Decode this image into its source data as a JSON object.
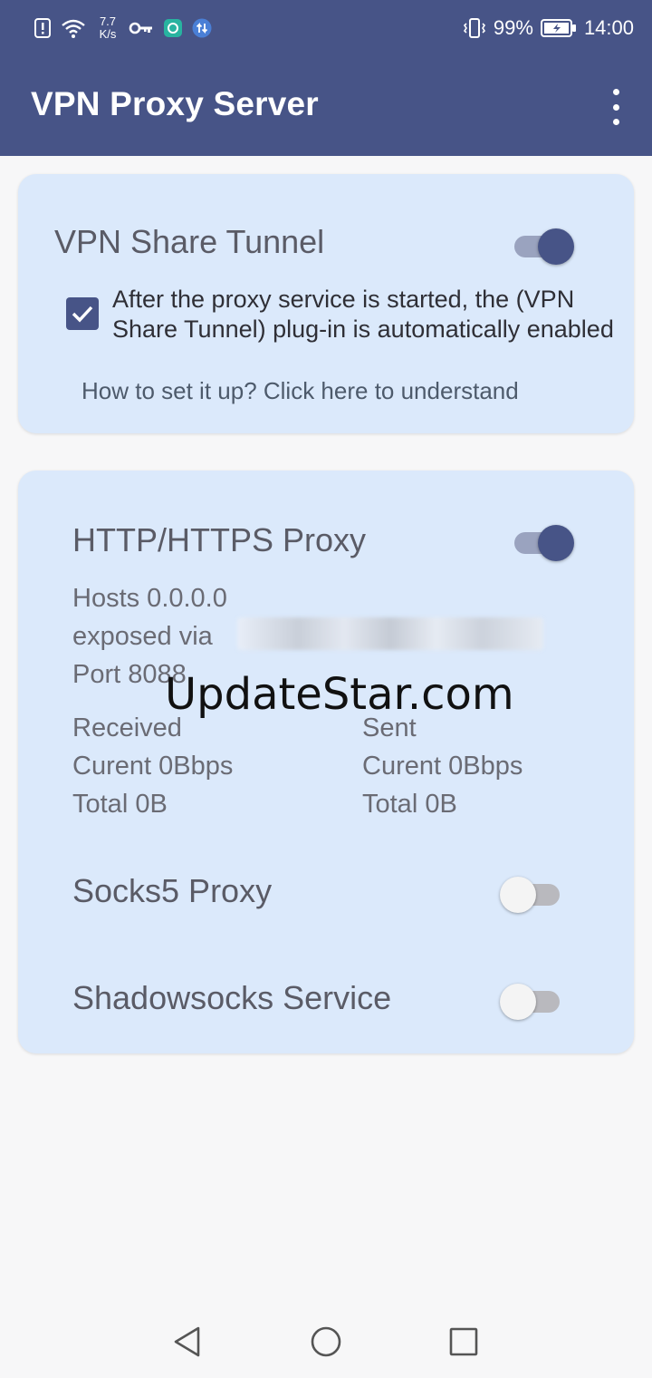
{
  "status_bar": {
    "net_speed_value": "7.7",
    "net_speed_unit": "K/s",
    "battery": "99%",
    "time": "14:00",
    "icons": [
      "alert-icon",
      "wifi-icon",
      "key-icon",
      "app-icon",
      "vpn-sync-icon",
      "vibrate-icon",
      "battery-icon"
    ]
  },
  "app_bar": {
    "title": "VPN Proxy Server",
    "overflow_icon": "more-vert-icon"
  },
  "vpn_card": {
    "title": "VPN Share Tunnel",
    "toggle_on": true,
    "checkbox_checked": true,
    "checkbox_label": "After the proxy service is started, the (VPN Share Tunnel) plug-in is automatically enabled",
    "help_link": "How to set it up? Click here to understand"
  },
  "proxy_card": {
    "http": {
      "title": "HTTP/HTTPS Proxy",
      "toggle_on": true,
      "hosts": "Hosts 0.0.0.0",
      "exposed": "exposed via",
      "port": "Port 8088",
      "received_label": "Received",
      "received_current": "Curent 0Bbps",
      "received_total": "Total 0B",
      "sent_label": "Sent",
      "sent_current": "Curent 0Bbps",
      "sent_total": "Total 0B"
    },
    "socks5": {
      "title": "Socks5 Proxy",
      "toggle_on": false
    },
    "shadowsocks": {
      "title": "Shadowsocks Service",
      "toggle_on": false
    }
  },
  "watermark": "UpdateStar.com",
  "nav_bar": {
    "icons": [
      "back-icon",
      "home-icon",
      "recents-icon"
    ]
  },
  "colors": {
    "primary": "#475487",
    "card_bg": "#dbe9fb",
    "background": "#f7f7f8"
  }
}
